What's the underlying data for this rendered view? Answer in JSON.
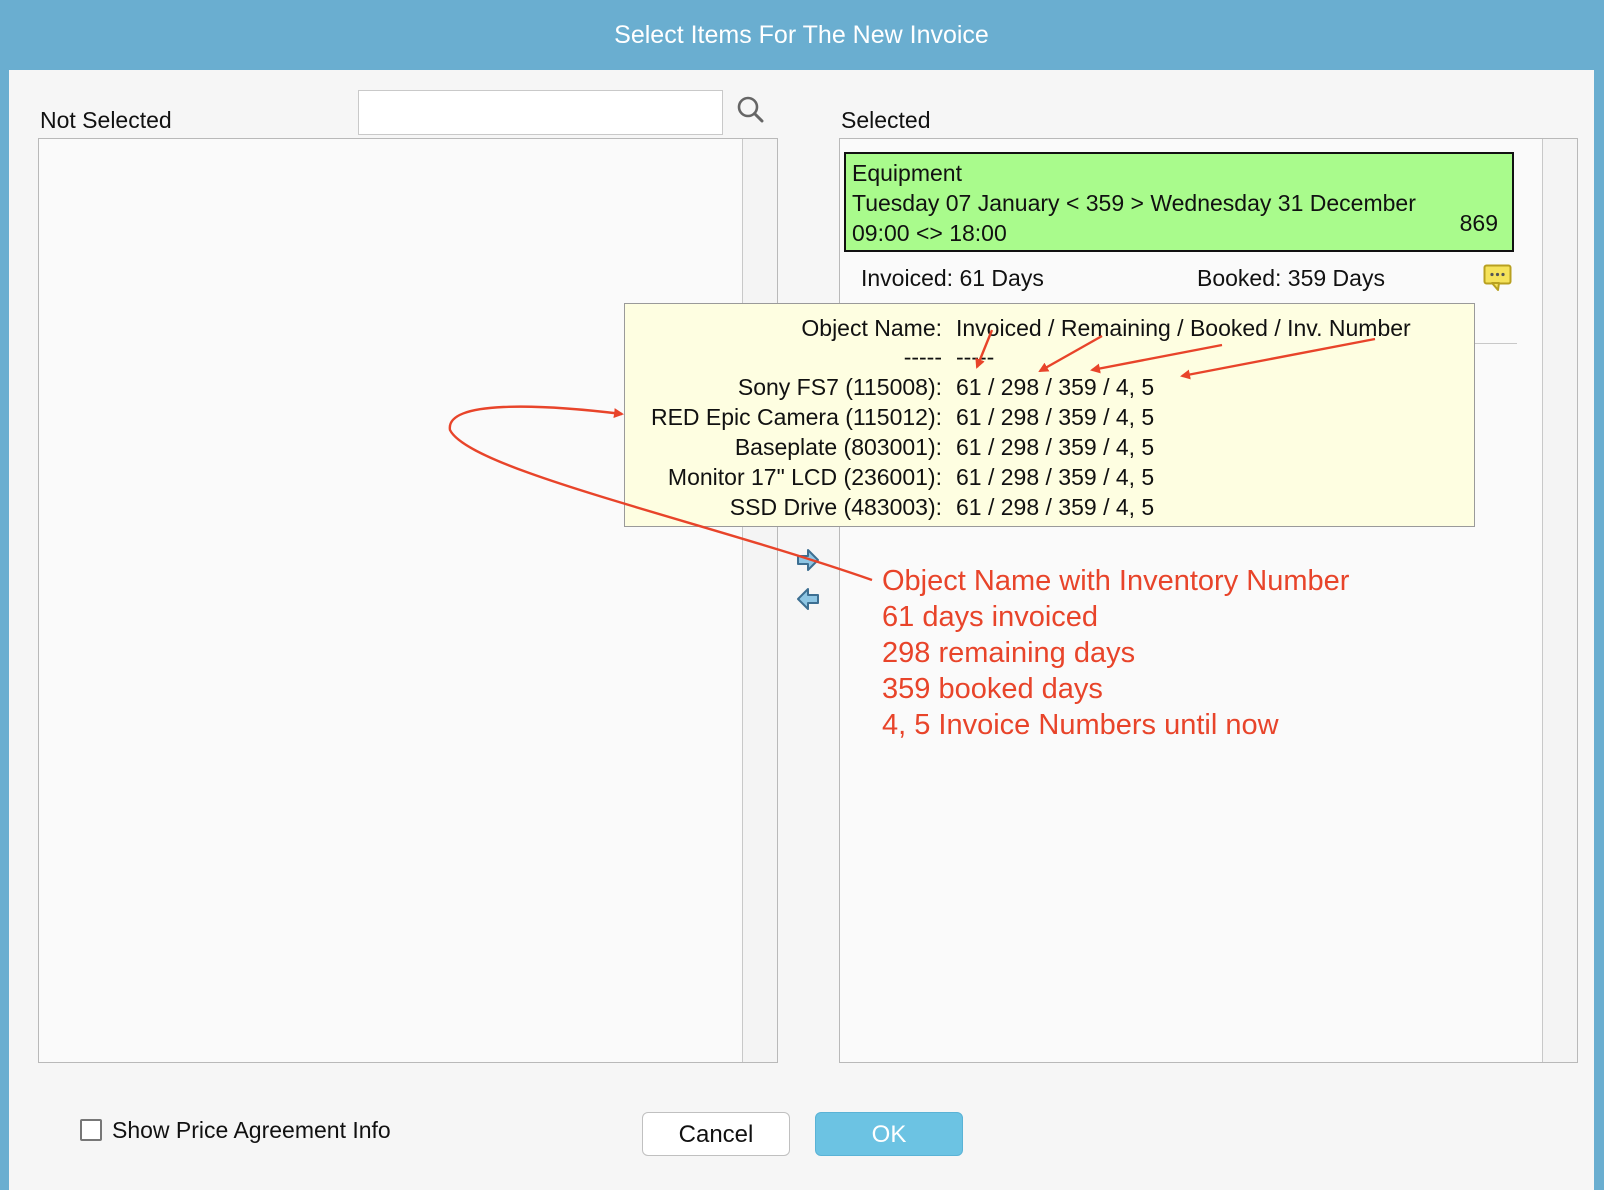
{
  "window": {
    "title": "Select Items For The New Invoice"
  },
  "not_selected": {
    "label": "Not Selected",
    "search_value": ""
  },
  "selected": {
    "label": "Selected",
    "booking": {
      "category": "Equipment",
      "date_range": "Tuesday 07 January < 359 > Wednesday 31 December",
      "time_range": "09:00 <> 18:00",
      "number": "869",
      "invoiced": "Invoiced: 61 Days",
      "booked": "Booked: 359 Days"
    }
  },
  "tooltip": {
    "header_name": "Object Name:",
    "header_values": "Invoiced / Remaining / Booked / Inv. Number",
    "divider_name": "-----",
    "divider_values": "-----",
    "rows": [
      {
        "name": "Sony FS7 (115008):",
        "values": "61 / 298 / 359 / 4, 5"
      },
      {
        "name": "RED Epic Camera (115012):",
        "values": "61 / 298 / 359 / 4, 5"
      },
      {
        "name": "Baseplate (803001):",
        "values": "61 / 298 / 359 / 4, 5"
      },
      {
        "name": "Monitor 17\" LCD (236001):",
        "values": "61 / 298 / 359 / 4, 5"
      },
      {
        "name": "SSD Drive (483003):",
        "values": "61 / 298 / 359 / 4, 5"
      }
    ]
  },
  "annotation": {
    "lines": [
      "Object Name with Inventory Number",
      "61 days invoiced",
      "298 remaining days",
      "359 booked days",
      "4, 5 Invoice Numbers until now"
    ],
    "color": "#e8442a"
  },
  "footer": {
    "checkbox_label": "Show Price Agreement Info",
    "cancel_label": "Cancel",
    "ok_label": "OK"
  },
  "colors": {
    "titlebar": "#6aaed0",
    "booking_bg": "#a9fb8c",
    "tooltip_bg": "#fefee1",
    "ok_button": "#6cc3e3"
  },
  "icons": [
    "search-icon",
    "comment-icon",
    "arrow-right-icon",
    "arrow-left-icon"
  ]
}
